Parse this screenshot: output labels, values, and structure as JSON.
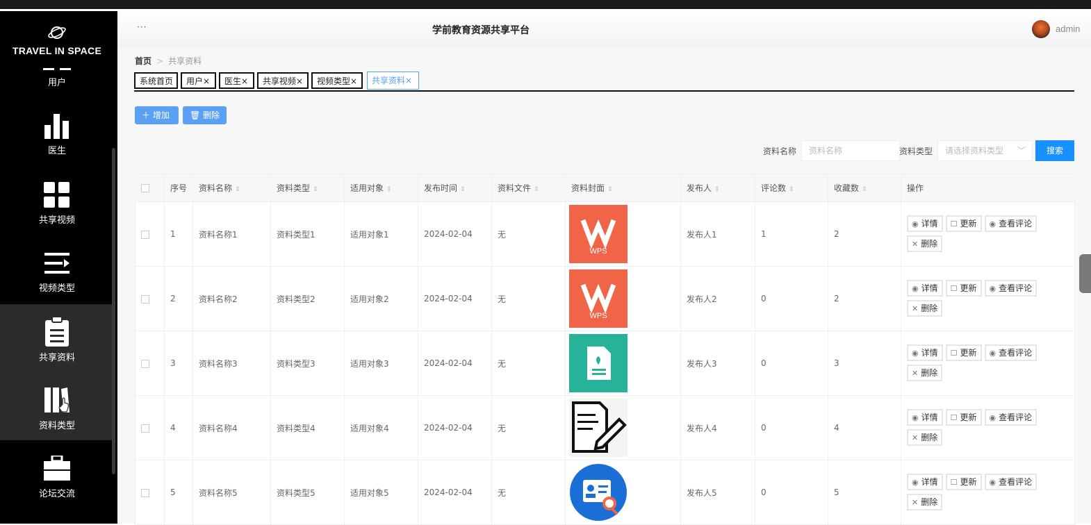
{
  "brand": {
    "name": "TRAVEL IN SPACE"
  },
  "sidebar": {
    "items": [
      {
        "label": "用户",
        "icon": "user-icon"
      },
      {
        "label": "医生",
        "icon": "bar-chart-icon"
      },
      {
        "label": "共享视频",
        "icon": "grid-icon"
      },
      {
        "label": "视频类型",
        "icon": "list-icon"
      },
      {
        "label": "共享资料",
        "icon": "clipboard-icon",
        "active": true
      },
      {
        "label": "资料类型",
        "icon": "book-icon",
        "active": true
      },
      {
        "label": "论坛交流",
        "icon": "briefcase-icon"
      }
    ]
  },
  "header": {
    "title": "学前教育资源共享平台",
    "user": "admin",
    "menu": "···"
  },
  "breadcrumb": {
    "home": "首页",
    "sep": ">",
    "current": "共享资料"
  },
  "tabs": [
    {
      "label": "系统首页"
    },
    {
      "label": "用户×"
    },
    {
      "label": "医生×"
    },
    {
      "label": "共享视频×"
    },
    {
      "label": "视频类型×"
    },
    {
      "label": "共享资料×",
      "active": true
    }
  ],
  "toolbar": {
    "add_label": "＋ 增加",
    "delete_label": "🗑 删除"
  },
  "search": {
    "name_label": "资料名称",
    "name_placeholder": "资料名称",
    "type_label": "资料类型",
    "type_placeholder": "请选择资料类型",
    "button": "搜索"
  },
  "table": {
    "columns": [
      "序号",
      "资料名称",
      "资料类型",
      "适用对象",
      "发布时间",
      "资料文件",
      "资料封面",
      "发布人",
      "评论数",
      "收藏数",
      "操作"
    ],
    "rows": [
      {
        "no": "1",
        "name": "资料名称1",
        "type": "资料类型1",
        "target": "适用对象1",
        "date": "2024-02-04",
        "file": "无",
        "cover": "wps",
        "publisher": "发布人1",
        "comments": "1",
        "favorites": "2"
      },
      {
        "no": "2",
        "name": "资料名称2",
        "type": "资料类型2",
        "target": "适用对象2",
        "date": "2024-02-04",
        "file": "无",
        "cover": "wps",
        "publisher": "发布人2",
        "comments": "0",
        "favorites": "2"
      },
      {
        "no": "3",
        "name": "资料名称3",
        "type": "资料类型3",
        "target": "适用对象3",
        "date": "2024-02-04",
        "file": "无",
        "cover": "doc-green",
        "publisher": "发布人3",
        "comments": "0",
        "favorites": "3"
      },
      {
        "no": "4",
        "name": "资料名称4",
        "type": "资料类型4",
        "target": "适用对象4",
        "date": "2024-02-04",
        "file": "无",
        "cover": "doc-pen",
        "publisher": "发布人4",
        "comments": "0",
        "favorites": "4"
      },
      {
        "no": "5",
        "name": "资料名称5",
        "type": "资料类型5",
        "target": "适用对象5",
        "date": "2024-02-04",
        "file": "无",
        "cover": "id-search",
        "publisher": "发布人5",
        "comments": "0",
        "favorites": "5"
      }
    ],
    "actions": {
      "detail": "详情",
      "update": "更新",
      "comments": "查看评论",
      "delete": "删除"
    }
  },
  "colors": {
    "primary": "#5aa1f5",
    "search_button": "#1890ff",
    "sidebar": "#000000",
    "wps": "#f06448",
    "green": "#26b39a",
    "blue": "#1a6fd6"
  }
}
